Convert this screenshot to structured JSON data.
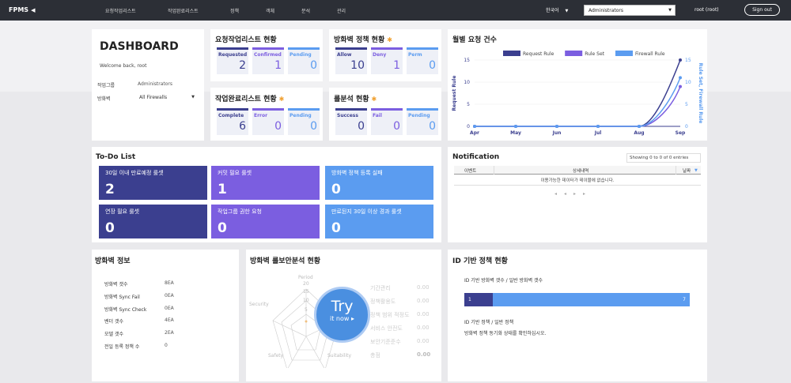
{
  "brand": "FPMS",
  "nav": [
    "요청작업리스트",
    "작업완료리스트",
    "정책",
    "객체",
    "분석",
    "관리"
  ],
  "lang": "한국어",
  "group_select": "Administrators",
  "user": "root (root)",
  "signout": "Sign out",
  "dashboard": {
    "title": "DASHBOARD",
    "welcome": "Welcome back, root",
    "group_label": "작업그룹",
    "group_value": "Administrators",
    "fw_label": "방화벽",
    "fw_value": "All Firewalls"
  },
  "request": {
    "title": "요청작업리스트 현황",
    "items": [
      {
        "label": "Requested",
        "value": "2",
        "color": "#3b3f8f"
      },
      {
        "label": "Confirmed",
        "value": "1",
        "color": "#7b5ee0"
      },
      {
        "label": "Pending",
        "value": "0",
        "color": "#5b9cf0"
      }
    ]
  },
  "fwpolicy": {
    "title": "방화벽 정책 현황",
    "items": [
      {
        "label": "Allow",
        "value": "10",
        "color": "#3b3f8f"
      },
      {
        "label": "Deny",
        "value": "1",
        "color": "#7b5ee0"
      },
      {
        "label": "Perm",
        "value": "0",
        "color": "#5b9cf0"
      }
    ]
  },
  "done": {
    "title": "작업완료리스트 현황",
    "items": [
      {
        "label": "Complete",
        "value": "6",
        "color": "#3b3f8f"
      },
      {
        "label": "Error",
        "value": "0",
        "color": "#7b5ee0"
      },
      {
        "label": "Pending",
        "value": "0",
        "color": "#5b9cf0"
      }
    ]
  },
  "rule": {
    "title": "룰분석 현황",
    "items": [
      {
        "label": "Success",
        "value": "0",
        "color": "#3b3f8f"
      },
      {
        "label": "Fail",
        "value": "0",
        "color": "#7b5ee0"
      },
      {
        "label": "Pending",
        "value": "0",
        "color": "#5b9cf0"
      }
    ]
  },
  "chart_data": {
    "type": "line",
    "title": "월별 요청 건수",
    "categories": [
      "Apr",
      "May",
      "Jun",
      "Jul",
      "Aug",
      "Sep"
    ],
    "series": [
      {
        "name": "Request Rule",
        "values": [
          0,
          0,
          0,
          0,
          0,
          15
        ],
        "color": "#3b3f8f"
      },
      {
        "name": "Rule Set",
        "values": [
          0,
          0,
          0,
          0,
          0,
          9
        ],
        "color": "#7b5ee0"
      },
      {
        "name": "Firewall Rule",
        "values": [
          0,
          0,
          0,
          0,
          0,
          11
        ],
        "color": "#5b9cf0"
      }
    ],
    "ylabel": "Request Rule",
    "ylabel2": "Rule Set, Firewall Rule",
    "yticks": [
      "0",
      "5",
      "10",
      "15"
    ],
    "ylim": [
      0,
      15
    ]
  },
  "todo": {
    "title": "To-Do List",
    "items": [
      {
        "label": "30일 이내 만료예정 룰셋",
        "value": "2",
        "color": "#3b3f8f"
      },
      {
        "label": "커밋 필요 룰셋",
        "value": "1",
        "color": "#7b5ee0"
      },
      {
        "label": "방화벽 정책 등록 실패",
        "value": "0",
        "color": "#5b9cf0"
      },
      {
        "label": "연장 필요 룰셋",
        "value": "0",
        "color": "#3b3f8f"
      },
      {
        "label": "작업그룹 권한 요청",
        "value": "0",
        "color": "#7b5ee0"
      },
      {
        "label": "만료된지 30일 이상 경과 룰셋",
        "value": "0",
        "color": "#5b9cf0"
      }
    ]
  },
  "notification": {
    "title": "Notification",
    "showing": "Showing 0 to 0 of 0 entries",
    "cols": [
      "이벤트",
      "상세내역",
      "날짜"
    ],
    "empty": "이용가능한 데이터가 테이블에 없습니다."
  },
  "fwinfo": {
    "title": "방화벽 정보",
    "rows": [
      {
        "k": "방화벽 갯수",
        "v": "8EA"
      },
      {
        "k": "방화벽 Sync Fail",
        "v": "0EA"
      },
      {
        "k": "방화벽 Sync Check",
        "v": "0EA"
      },
      {
        "k": "벤더 갯수",
        "v": "4EA"
      },
      {
        "k": "모델 갯수",
        "v": "2EA"
      },
      {
        "k": "전일 등록 정책 수",
        "v": "0"
      }
    ]
  },
  "riskanalysis": {
    "title": "방화벽 룰보안분석 현황",
    "try": "Try",
    "trynow": "it now ▸",
    "radar": [
      "Period",
      "Security",
      "Safety",
      "Suitability"
    ],
    "rticks": [
      "20",
      "15",
      "10",
      "5"
    ],
    "items": [
      {
        "k": "기간관리",
        "v": "0.00"
      },
      {
        "k": "정책활용도",
        "v": "0.00"
      },
      {
        "k": "정책 범위 적정도",
        "v": "0.00"
      },
      {
        "k": "서비스 안전도",
        "v": "0.00"
      },
      {
        "k": "보안기준준수",
        "v": "0.00"
      },
      {
        "k": "총점",
        "v": "0.00"
      }
    ]
  },
  "idpolicy": {
    "title": "ID 기반 정책 현황",
    "sub1": "ID 기반 방화벽 갯수 / 일반 방화벽 갯수",
    "bar_left": "1",
    "bar_right": "7",
    "bar_frac": 0.125,
    "sub2": "ID 기반 정책 / 일반 정책",
    "msg": "방화벽 정책 동기화 상태를 확인하십시오."
  }
}
